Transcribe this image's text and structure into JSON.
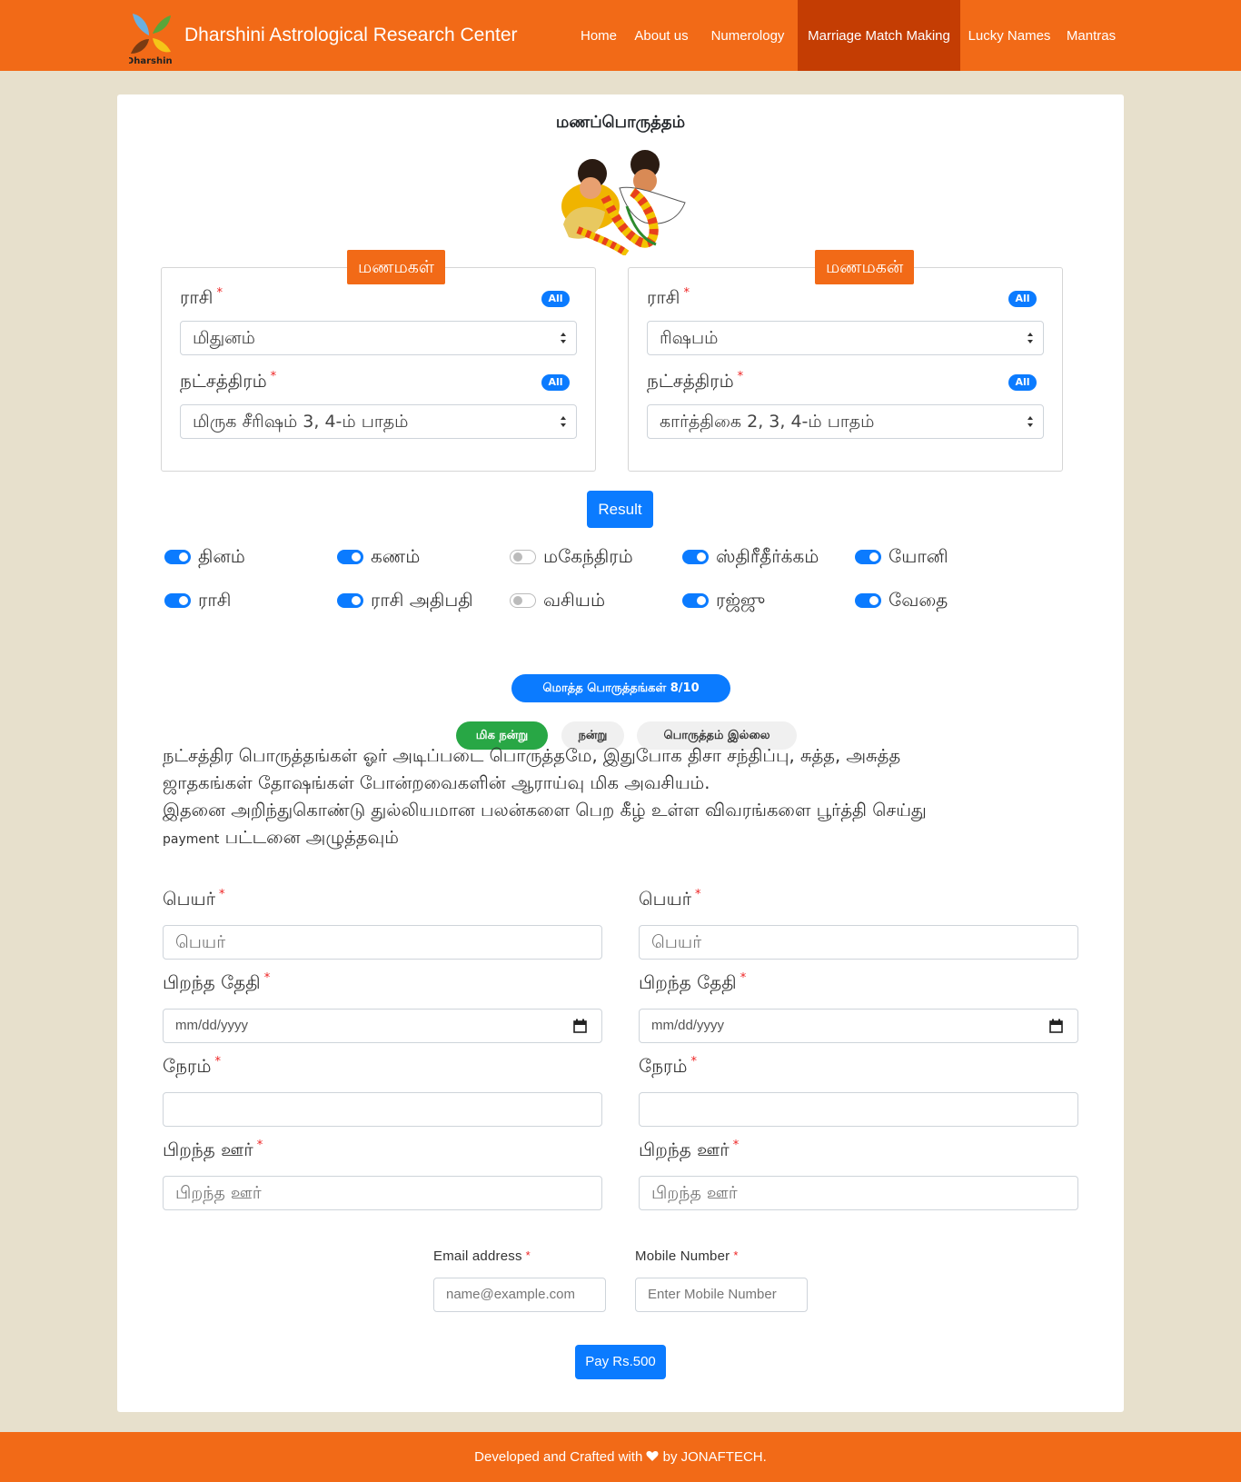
{
  "brand": {
    "logo_text": "Dharshini",
    "name": "Dharshini Astrological Research Center"
  },
  "nav": [
    {
      "label": "Home",
      "active": false
    },
    {
      "label": "About us",
      "active": false
    },
    {
      "label": "Numerology",
      "active": false
    },
    {
      "label": "Marriage Match Making",
      "active": true
    },
    {
      "label": "Lucky Names",
      "active": false
    },
    {
      "label": "Mantras",
      "active": false
    }
  ],
  "page_title": "மணப்பொருத்தம்",
  "bride": {
    "legend": "மணமகள்",
    "rasi_label": "ராசி",
    "rasi_badge": "All",
    "rasi_value": "மிதுனம்",
    "star_label": "நட்சத்திரம்",
    "star_badge": "All",
    "star_value": "மிருக சீரிஷம் 3, 4-ம் பாதம்"
  },
  "groom": {
    "legend": "மணமகன்",
    "rasi_label": "ராசி",
    "rasi_badge": "All",
    "rasi_value": "ரிஷபம்",
    "star_label": "நட்சத்திரம்",
    "star_badge": "All",
    "star_value": "கார்த்திகை 2, 3, 4-ம் பாதம்"
  },
  "required_mark": "*",
  "result_button": "Result",
  "poruthams": [
    {
      "label": "தினம்",
      "on": true
    },
    {
      "label": "கணம்",
      "on": true
    },
    {
      "label": "மகேந்திரம்",
      "on": false
    },
    {
      "label": "ஸ்திரீதீர்க்கம்",
      "on": true
    },
    {
      "label": "யோனி",
      "on": true
    },
    {
      "label": "ராசி",
      "on": true
    },
    {
      "label": "ராசி அதிபதி",
      "on": true
    },
    {
      "label": "வசியம்",
      "on": false
    },
    {
      "label": "ரஜ்ஜு",
      "on": true
    },
    {
      "label": "வேதை",
      "on": true
    }
  ],
  "total": "மொத்த பொருத்தங்கள் 8/10",
  "legend_pills": [
    "மிக நன்று",
    "நன்று",
    "பொருத்தம் இல்லை"
  ],
  "info": {
    "line1": "நட்சத்திர பொருத்தங்கள் ஓர் அடிப்படை பொருத்தமே, இதுபோக திசா சந்திப்பு, சுத்த, அசுத்த",
    "line2": "ஜாதகங்கள் தோஷங்கள் போன்றவைகளின் ஆராய்வு மிக அவசியம்.",
    "line3": "இதனை அறிந்துகொண்டு துல்லியமான பலன்களை பெற கீழ் உள்ள விவரங்களை பூர்த்தி செய்து",
    "line4_small": "payment",
    "line4": " பட்டனை அழுத்தவும்"
  },
  "form_left": {
    "name_label": "பெயர்",
    "name_placeholder": "பெயர்",
    "dob_label": "பிறந்த தேதி",
    "dob_placeholder": "mm/dd/yyyy",
    "time_label": "நேரம்",
    "time_value": "",
    "place_label": "பிறந்த ஊர்",
    "place_placeholder": "பிறந்த ஊர்"
  },
  "form_right": {
    "name_label": "பெயர்",
    "name_placeholder": "பெயர்",
    "dob_label": "பிறந்த தேதி",
    "dob_placeholder": "mm/dd/yyyy",
    "time_label": "நேரம்",
    "time_value": "",
    "place_label": "பிறந்த ஊர்",
    "place_placeholder": "பிறந்த ஊர்"
  },
  "contact": {
    "email_label": "Email address",
    "email_placeholder": "name@example.com",
    "mobile_label": "Mobile Number",
    "mobile_placeholder": "Enter Mobile Number"
  },
  "pay_button": "Pay Rs.500",
  "footer": {
    "before": "Developed and Crafted with ",
    "icon": "heart-icon",
    "after": " by JONAFTECH."
  },
  "colors": {
    "brand_orange": "#f26a17",
    "active_nav": "#c43d03",
    "primary_blue": "#0b7bff",
    "success_green": "#28a745",
    "page_bg": "#e7e0cc"
  }
}
